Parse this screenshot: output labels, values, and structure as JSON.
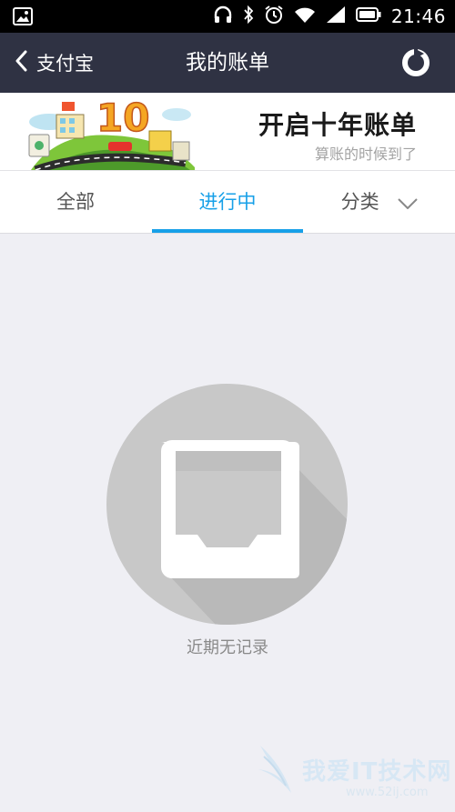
{
  "status_bar": {
    "time": "21:46",
    "icons": [
      "image-icon",
      "headphones-icon",
      "bluetooth-icon",
      "alarm-icon",
      "wifi-icon",
      "signal-icon",
      "battery-icon"
    ]
  },
  "nav": {
    "back_label": "支付宝",
    "title": "我的账单",
    "right_icon": "statistics-pie-icon"
  },
  "banner": {
    "badge": "10",
    "title": "开启十年账单",
    "subtitle": "算账的时候到了"
  },
  "tabs": [
    {
      "label": "全部",
      "active": false
    },
    {
      "label": "进行中",
      "active": true
    },
    {
      "label": "分类",
      "active": false,
      "icon": "chevron-down-icon"
    }
  ],
  "empty_state": {
    "icon": "empty-inbox-icon",
    "message": "近期无记录"
  },
  "watermark": {
    "text": "我爱IT技术网",
    "url": "www.52ij.com"
  },
  "colors": {
    "navbar": "#2f3243",
    "accent": "#17a0e8",
    "background": "#efeff4"
  }
}
